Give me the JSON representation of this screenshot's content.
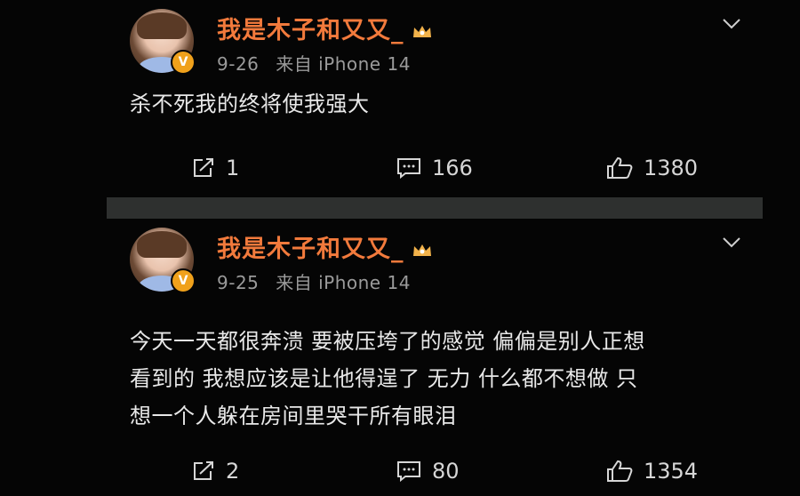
{
  "posts": [
    {
      "username": "我是木子和又又_",
      "date": "9-26",
      "source": "来自 iPhone 14",
      "content_lines": [
        "杀不死我的终将使我强大"
      ],
      "reposts": "1",
      "comments": "166",
      "likes": "1380"
    },
    {
      "username": "我是木子和又又_",
      "date": "9-25",
      "source": "来自 iPhone 14",
      "content_lines": [
        "今天一天都很奔溃 要被压垮了的感觉 偏偏是别人正想",
        "看到的 我想应该是让他得逞了 无力 什么都不想做 只",
        "想一个人躲在房间里哭干所有眼泪"
      ],
      "reposts": "2",
      "comments": "80",
      "likes": "1354"
    }
  ],
  "verified_badge": "V",
  "colors": {
    "username": "#f27a3c",
    "meta": "#9a9a9a",
    "badge": "#f0a11b",
    "background": "#050505",
    "divider": "#2e302f"
  },
  "icons": {
    "repost": "repost-icon",
    "comment": "comment-icon",
    "like": "thumbs-up-icon",
    "more": "chevron-down-icon",
    "member": "crown-icon"
  }
}
